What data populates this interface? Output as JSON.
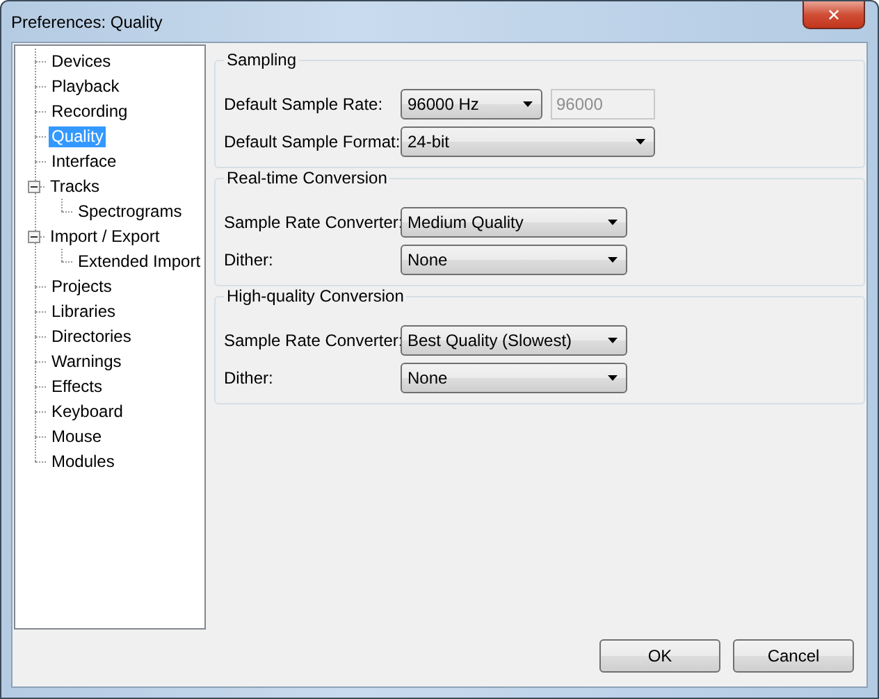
{
  "window": {
    "title": "Preferences: Quality",
    "close_label": "✕"
  },
  "tree": [
    {
      "label": "Devices",
      "selected": false
    },
    {
      "label": "Playback",
      "selected": false
    },
    {
      "label": "Recording",
      "selected": false
    },
    {
      "label": "Quality",
      "selected": true
    },
    {
      "label": "Interface",
      "selected": false
    },
    {
      "label": "Tracks",
      "selected": false,
      "expanded": true,
      "children": [
        {
          "label": "Spectrograms",
          "selected": false
        }
      ]
    },
    {
      "label": "Import / Export",
      "selected": false,
      "expanded": true,
      "children": [
        {
          "label": "Extended Import",
          "selected": false
        }
      ]
    },
    {
      "label": "Projects",
      "selected": false
    },
    {
      "label": "Libraries",
      "selected": false
    },
    {
      "label": "Directories",
      "selected": false
    },
    {
      "label": "Warnings",
      "selected": false
    },
    {
      "label": "Effects",
      "selected": false
    },
    {
      "label": "Keyboard",
      "selected": false
    },
    {
      "label": "Mouse",
      "selected": false
    },
    {
      "label": "Modules",
      "selected": false
    }
  ],
  "groups": [
    {
      "title": "Sampling",
      "rows": [
        {
          "label": "Default Sample Rate:",
          "dropdown": {
            "value": "96000 Hz"
          },
          "field": {
            "value": "96000",
            "disabled": true
          }
        },
        {
          "label": "Default Sample Format:",
          "dropdown": {
            "value": "24-bit"
          }
        }
      ]
    },
    {
      "title": "Real-time Conversion",
      "rows": [
        {
          "label": "Sample Rate Converter:",
          "dropdown": {
            "value": "Medium Quality"
          }
        },
        {
          "label": "Dither:",
          "dropdown": {
            "value": "None"
          }
        }
      ]
    },
    {
      "title": "High-quality Conversion",
      "rows": [
        {
          "label": "Sample Rate Converter:",
          "dropdown": {
            "value": "Best Quality (Slowest)"
          }
        },
        {
          "label": "Dither:",
          "dropdown": {
            "value": "None"
          }
        }
      ]
    }
  ],
  "buttons": [
    "OK",
    "Cancel"
  ]
}
